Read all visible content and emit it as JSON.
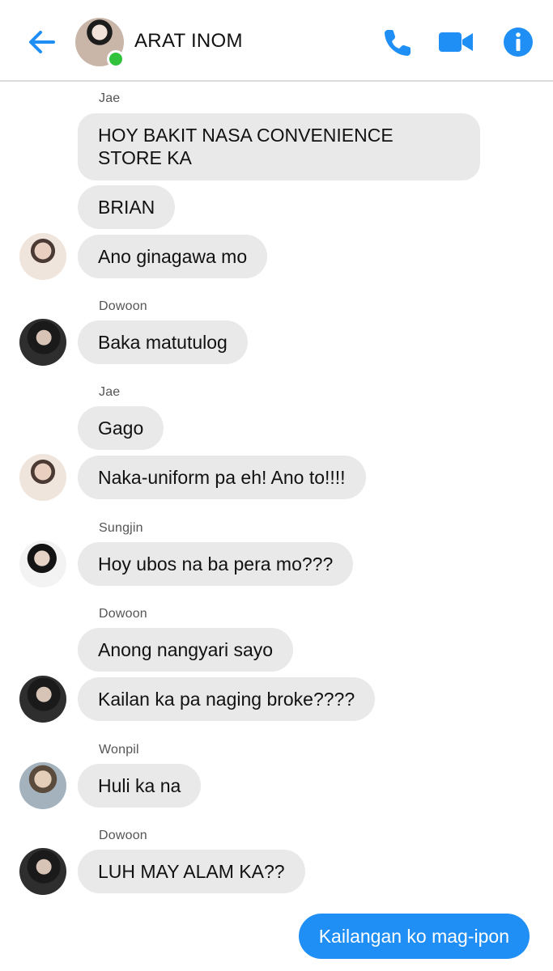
{
  "header": {
    "title": "ARAT INOM",
    "accent_color": "#1f8ef5",
    "online_color": "#31c23c",
    "icons": [
      "back-arrow-icon",
      "phone-icon",
      "video-camera-icon",
      "info-icon"
    ]
  },
  "thread": {
    "senders": {
      "s1": "Jae",
      "s2": "Dowoon",
      "s3": "Jae",
      "s4": "Sungjin",
      "s5": "Dowoon",
      "s6": "Wonpil",
      "s7": "Dowoon"
    },
    "messages": {
      "m1": "HOY BAKIT NASA CONVENIENCE STORE KA",
      "m2": "BRIAN",
      "m3": "Ano ginagawa mo",
      "m4": "Baka matutulog",
      "m5": "Gago",
      "m6": "Naka-uniform pa eh! Ano to!!!!",
      "m7": "Hoy ubos na ba pera mo???",
      "m8": "Anong nangyari sayo",
      "m9": "Kailan ka pa naging broke????",
      "m10": "Huli ka na",
      "m11": "LUH MAY ALAM KA??",
      "m12": "Kailangan ko mag-ipon"
    }
  }
}
